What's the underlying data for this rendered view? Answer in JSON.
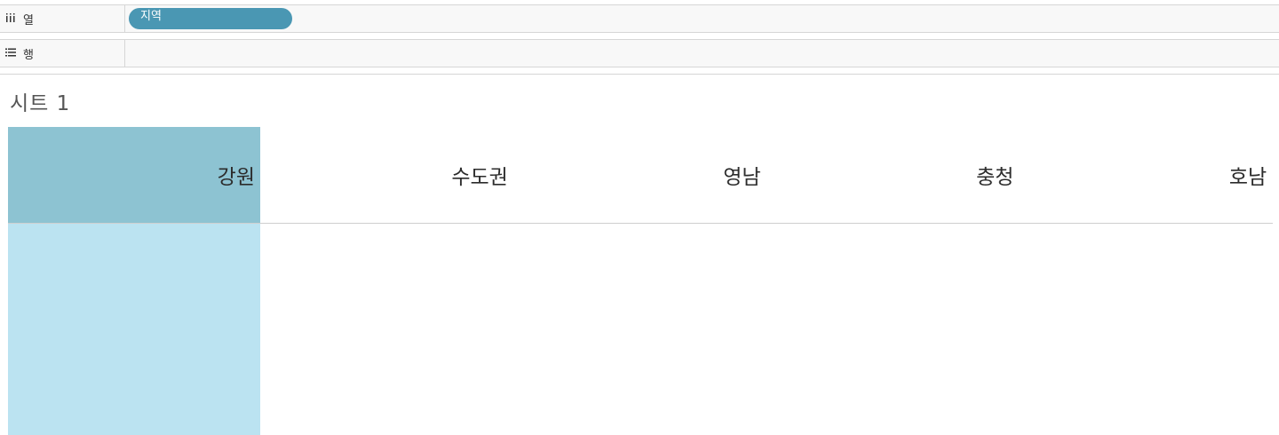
{
  "shelves": {
    "columns": {
      "icon": "column-bars-icon",
      "label": "열",
      "pills": [
        {
          "label": "지역",
          "color": "#4a97b3"
        }
      ]
    },
    "rows": {
      "icon": "row-list-icon",
      "label": "행"
    }
  },
  "sheet": {
    "title": "시트 1"
  },
  "colors": {
    "header_selected": "#8dc3d2",
    "body_selected": "#bbe3f1"
  },
  "table": {
    "columns": [
      {
        "label": "강원",
        "selected": true
      },
      {
        "label": "수도권",
        "selected": false
      },
      {
        "label": "영남",
        "selected": false
      },
      {
        "label": "충청",
        "selected": false
      },
      {
        "label": "호남",
        "selected": false
      }
    ]
  }
}
